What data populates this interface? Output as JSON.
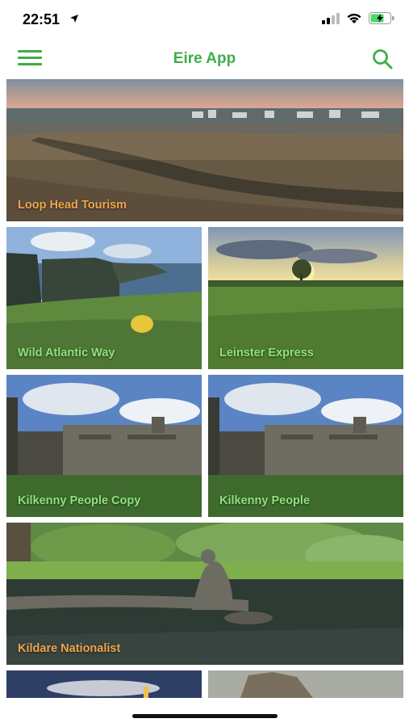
{
  "status": {
    "time": "22:51"
  },
  "header": {
    "title": "Eire App"
  },
  "tiles": [
    {
      "label": "Loop Head Tourism",
      "label_color": "#f0a64a"
    },
    {
      "label": "Wild Atlantic Way",
      "label_color": "#8fe37a"
    },
    {
      "label": "Leinster Express",
      "label_color": "#8fe37a"
    },
    {
      "label": "Kilkenny People Copy",
      "label_color": "#8fe37a"
    },
    {
      "label": "Kilkenny People",
      "label_color": "#8fe37a"
    },
    {
      "label": "Kildare Nationalist",
      "label_color": "#f0a64a"
    }
  ],
  "colors": {
    "accent": "#3fae49"
  },
  "icons": [
    "location-arrow-icon",
    "signal-icon",
    "wifi-icon",
    "battery-charging-icon",
    "hamburger-menu-icon",
    "search-icon"
  ]
}
